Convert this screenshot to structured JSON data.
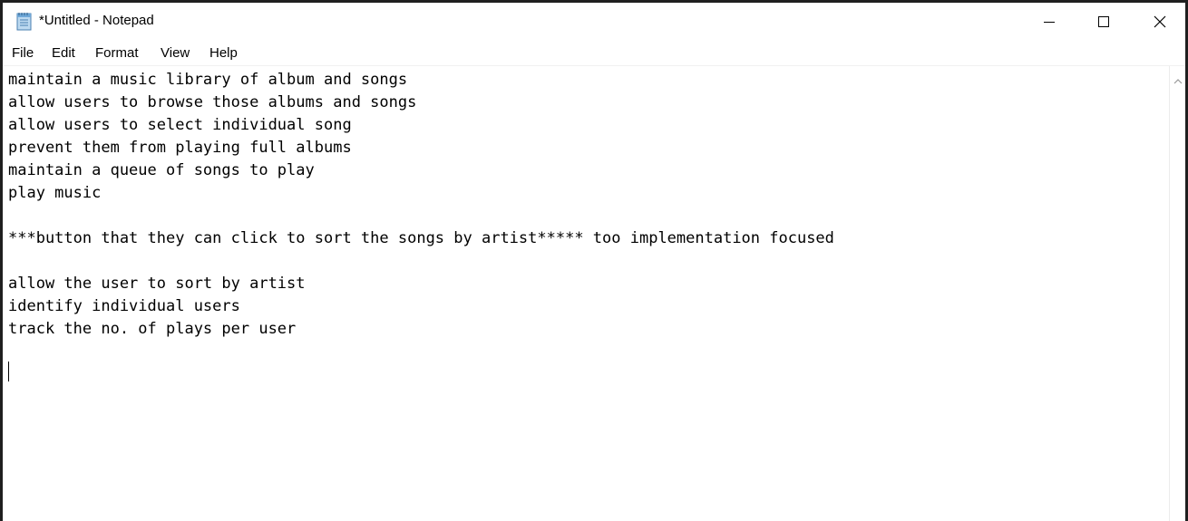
{
  "window": {
    "title": "*Untitled - Notepad",
    "icon": "notepad-icon"
  },
  "caption_buttons": {
    "minimize_icon": "minimize-icon",
    "maximize_icon": "maximize-icon",
    "close_icon": "close-icon"
  },
  "menu": {
    "items": [
      {
        "label": "File"
      },
      {
        "label": "Edit"
      },
      {
        "label": "Format"
      },
      {
        "label": "View"
      },
      {
        "label": "Help"
      }
    ]
  },
  "editor": {
    "lines": [
      "maintain a music library of album and songs",
      "allow users to browse those albums and songs",
      "allow users to select individual song",
      "prevent them from playing full albums",
      "maintain a queue of songs to play",
      "play music",
      "",
      "***button that they can click to sort the songs by artist***** too implementation focused",
      "",
      "allow the user to sort by artist",
      "identify individual users",
      "track the no. of plays per user",
      ""
    ]
  },
  "scrollbar": {
    "up_icon": "scroll-up-arrow-icon"
  }
}
